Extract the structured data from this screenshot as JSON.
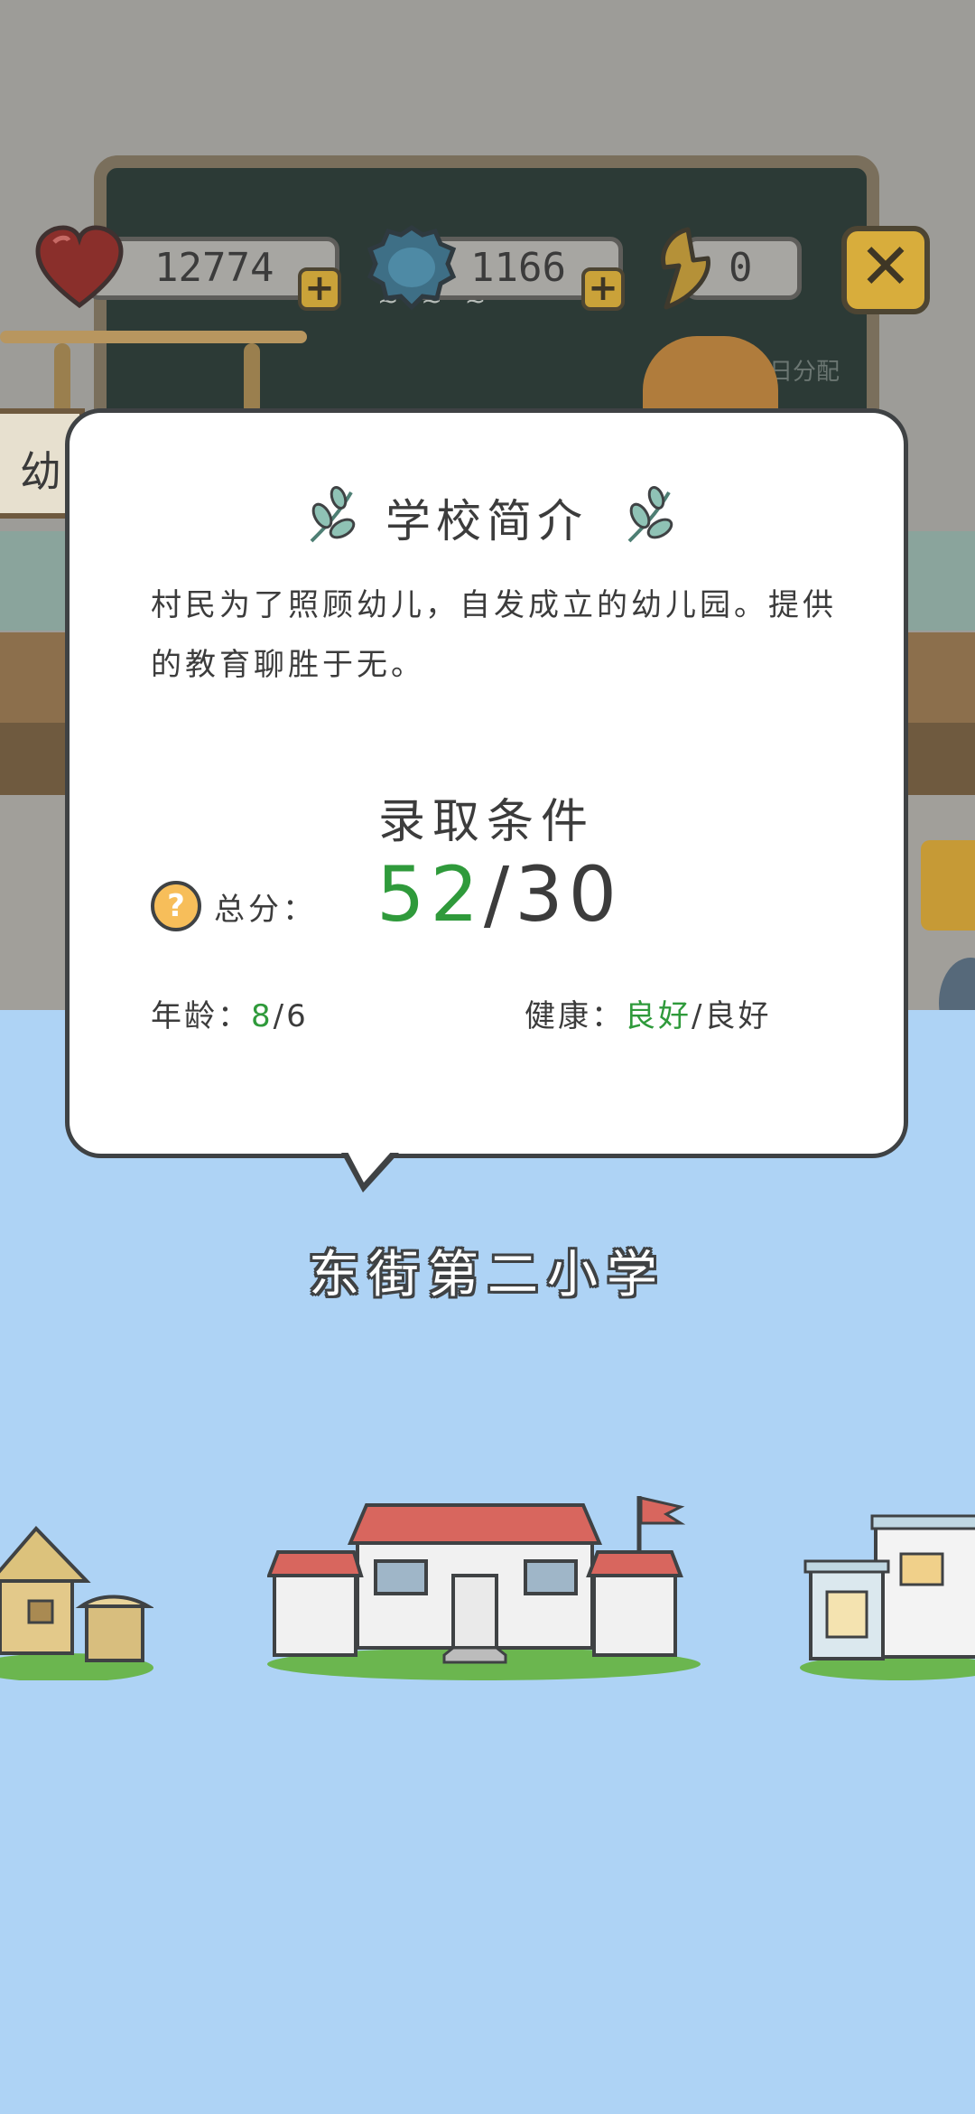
{
  "background_scene": {
    "sign_text": "幼",
    "board_text": "日分配"
  },
  "resources": {
    "hearts": {
      "value": "12774",
      "icon": "heart-icon"
    },
    "gems": {
      "value": "1166",
      "icon": "blue-gem-icon"
    },
    "bolts": {
      "value": "0",
      "icon": "lightning-icon"
    },
    "plus_label": "+",
    "close_label": "✕"
  },
  "popup": {
    "title": "学校简介",
    "intro": "村民为了照顾幼儿，自发成立的幼儿园。提供的教育聊胜于无。",
    "requirements_title": "录取条件",
    "help_label": "?",
    "score_label": "总分：",
    "score_current": "52",
    "score_sep": "/",
    "score_required": "30",
    "age_label": "年龄：",
    "age_current": "8",
    "age_sep": "/",
    "age_required": "6",
    "health_label": "健康：",
    "health_current": "良好",
    "health_sep": "/",
    "health_required": "良好"
  },
  "school": {
    "name": "东街第二小学"
  },
  "colors": {
    "sky": "#aed3f5",
    "accent_green": "#2f9a3b",
    "plus_gold": "#caa239"
  }
}
